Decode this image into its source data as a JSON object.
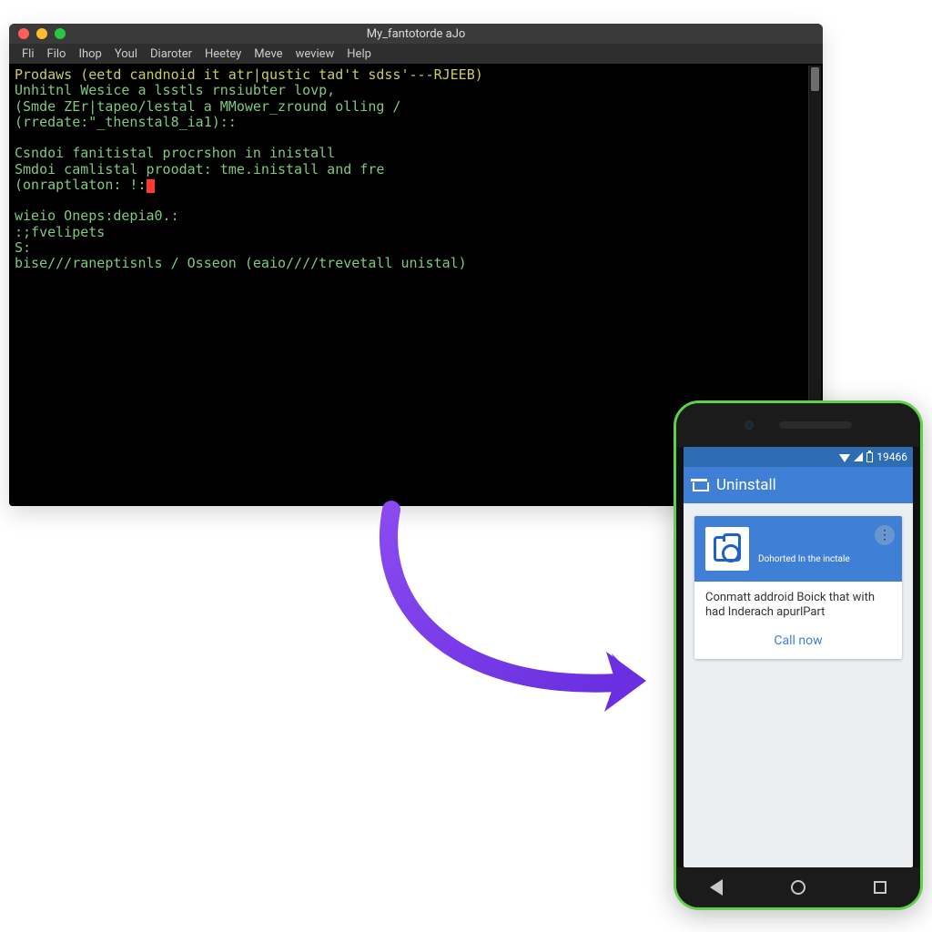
{
  "terminal": {
    "title": "My_fantotorde aJo",
    "menu": [
      "Fli",
      "Filo",
      "Ihop",
      "Youl",
      "Diaroter",
      "Heetey",
      "Meve",
      "weview",
      "Help"
    ],
    "lines": {
      "l1": "Prodaws (eetd candnoid it atr|qustic tad't sdss'---RJEEB)",
      "l2": "Unhitnl Wesice a lsstls rnsiubter lovp,",
      "l3": "(Smde ZEr|tapeo/lestal a MMower_zround olling /",
      "l4": "(rredate:\"_thenstal8_ia1)::",
      "l5": "Csndoi fanitistal procrshon in inistall",
      "l6": "Smdoi camlistal proodat: tme.inistall and fre",
      "l7": "(onraptlaton: !:",
      "l8": "wieio Oneps:depia0.:",
      "l9": ":;fvelipets",
      "l10": "S:",
      "l11": "bise///raneptisnls / Osseon (eaio////trevetall unistal)"
    }
  },
  "phone": {
    "statusbar": {
      "time": "19466"
    },
    "appbar": {
      "title": "Uninstall"
    },
    "card": {
      "subtitle": "Dohorted In the inctale",
      "body": "Conmatt addroid Boick that with had Inderach apurlPart",
      "action": "Call now"
    },
    "nav": {
      "back": "back",
      "home": "home",
      "recent": "recent"
    }
  },
  "arrow": {
    "color": "#7a3fe0"
  }
}
